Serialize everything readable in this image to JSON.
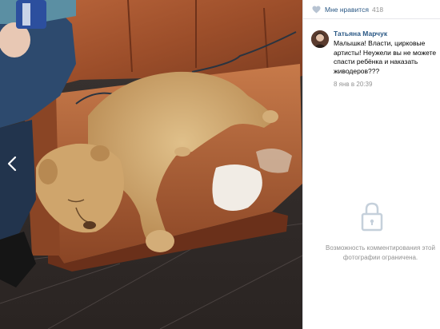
{
  "likes": {
    "label": "Мне нравится",
    "count": "418",
    "icon": "heart-icon"
  },
  "comment": {
    "author": "Татьяна Марчук",
    "text": "Малышка! Власти, цирковые артисты! Неужели вы не можете спасти ребёнка и наказать живодеров???",
    "date": "8 янв в 20:39"
  },
  "restricted": {
    "icon": "lock-icon",
    "line1": "Возможность комментирования этой",
    "line2": "фотографии ограничена."
  },
  "colors": {
    "link": "#2a5885",
    "muted": "#939393",
    "divider": "#e7e8ec"
  }
}
